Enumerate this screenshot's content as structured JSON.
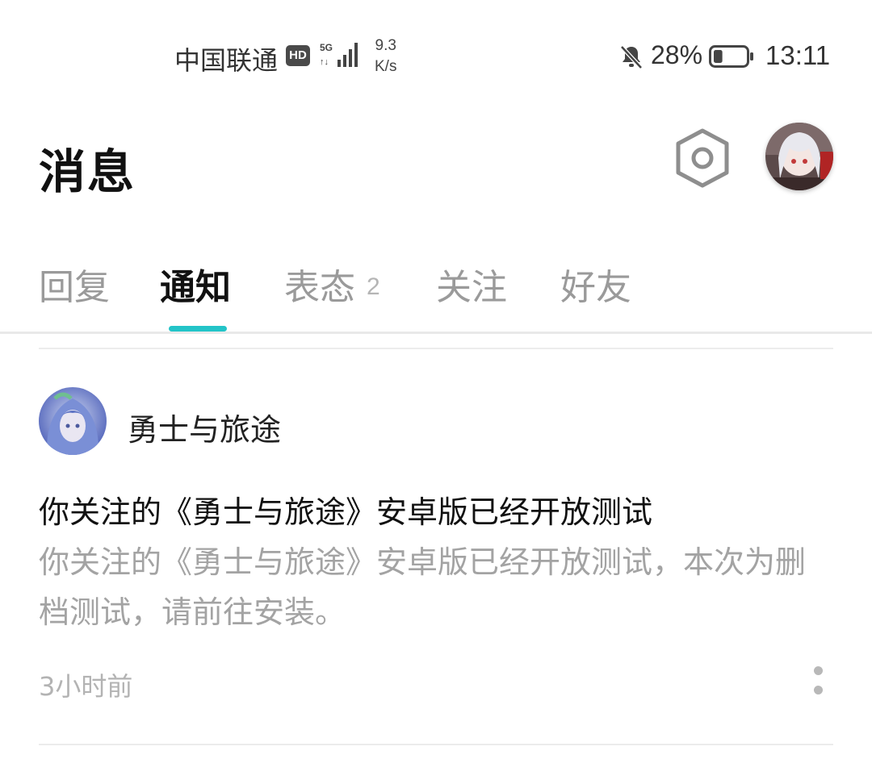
{
  "status_bar": {
    "carrier": "中国联通",
    "hd_badge": "HD",
    "network": "5G",
    "speed_value": "9.3",
    "speed_unit": "K/s",
    "battery_percent": "28%",
    "time": "13:11",
    "battery_level": 0.28
  },
  "header": {
    "title": "消息",
    "settings_icon": "hexagon-gear-icon",
    "avatar_icon": "user-avatar"
  },
  "tabs": [
    {
      "label": "回复",
      "active": false,
      "badge": ""
    },
    {
      "label": "通知",
      "active": true,
      "badge": ""
    },
    {
      "label": "表态",
      "active": false,
      "badge": "2"
    },
    {
      "label": "关注",
      "active": false,
      "badge": ""
    },
    {
      "label": "好友",
      "active": false,
      "badge": ""
    }
  ],
  "notification": {
    "sender": "勇士与旅途",
    "title": "你关注的《勇士与旅途》安卓版已经开放测试",
    "body": "你关注的《勇士与旅途》安卓版已经开放测试，本次为删档测试，请前往安装。",
    "time": "3小时前"
  },
  "colors": {
    "accent": "#23c4c8",
    "text_primary": "#111111",
    "text_muted": "#a3a3a3",
    "divider": "#ececec"
  }
}
